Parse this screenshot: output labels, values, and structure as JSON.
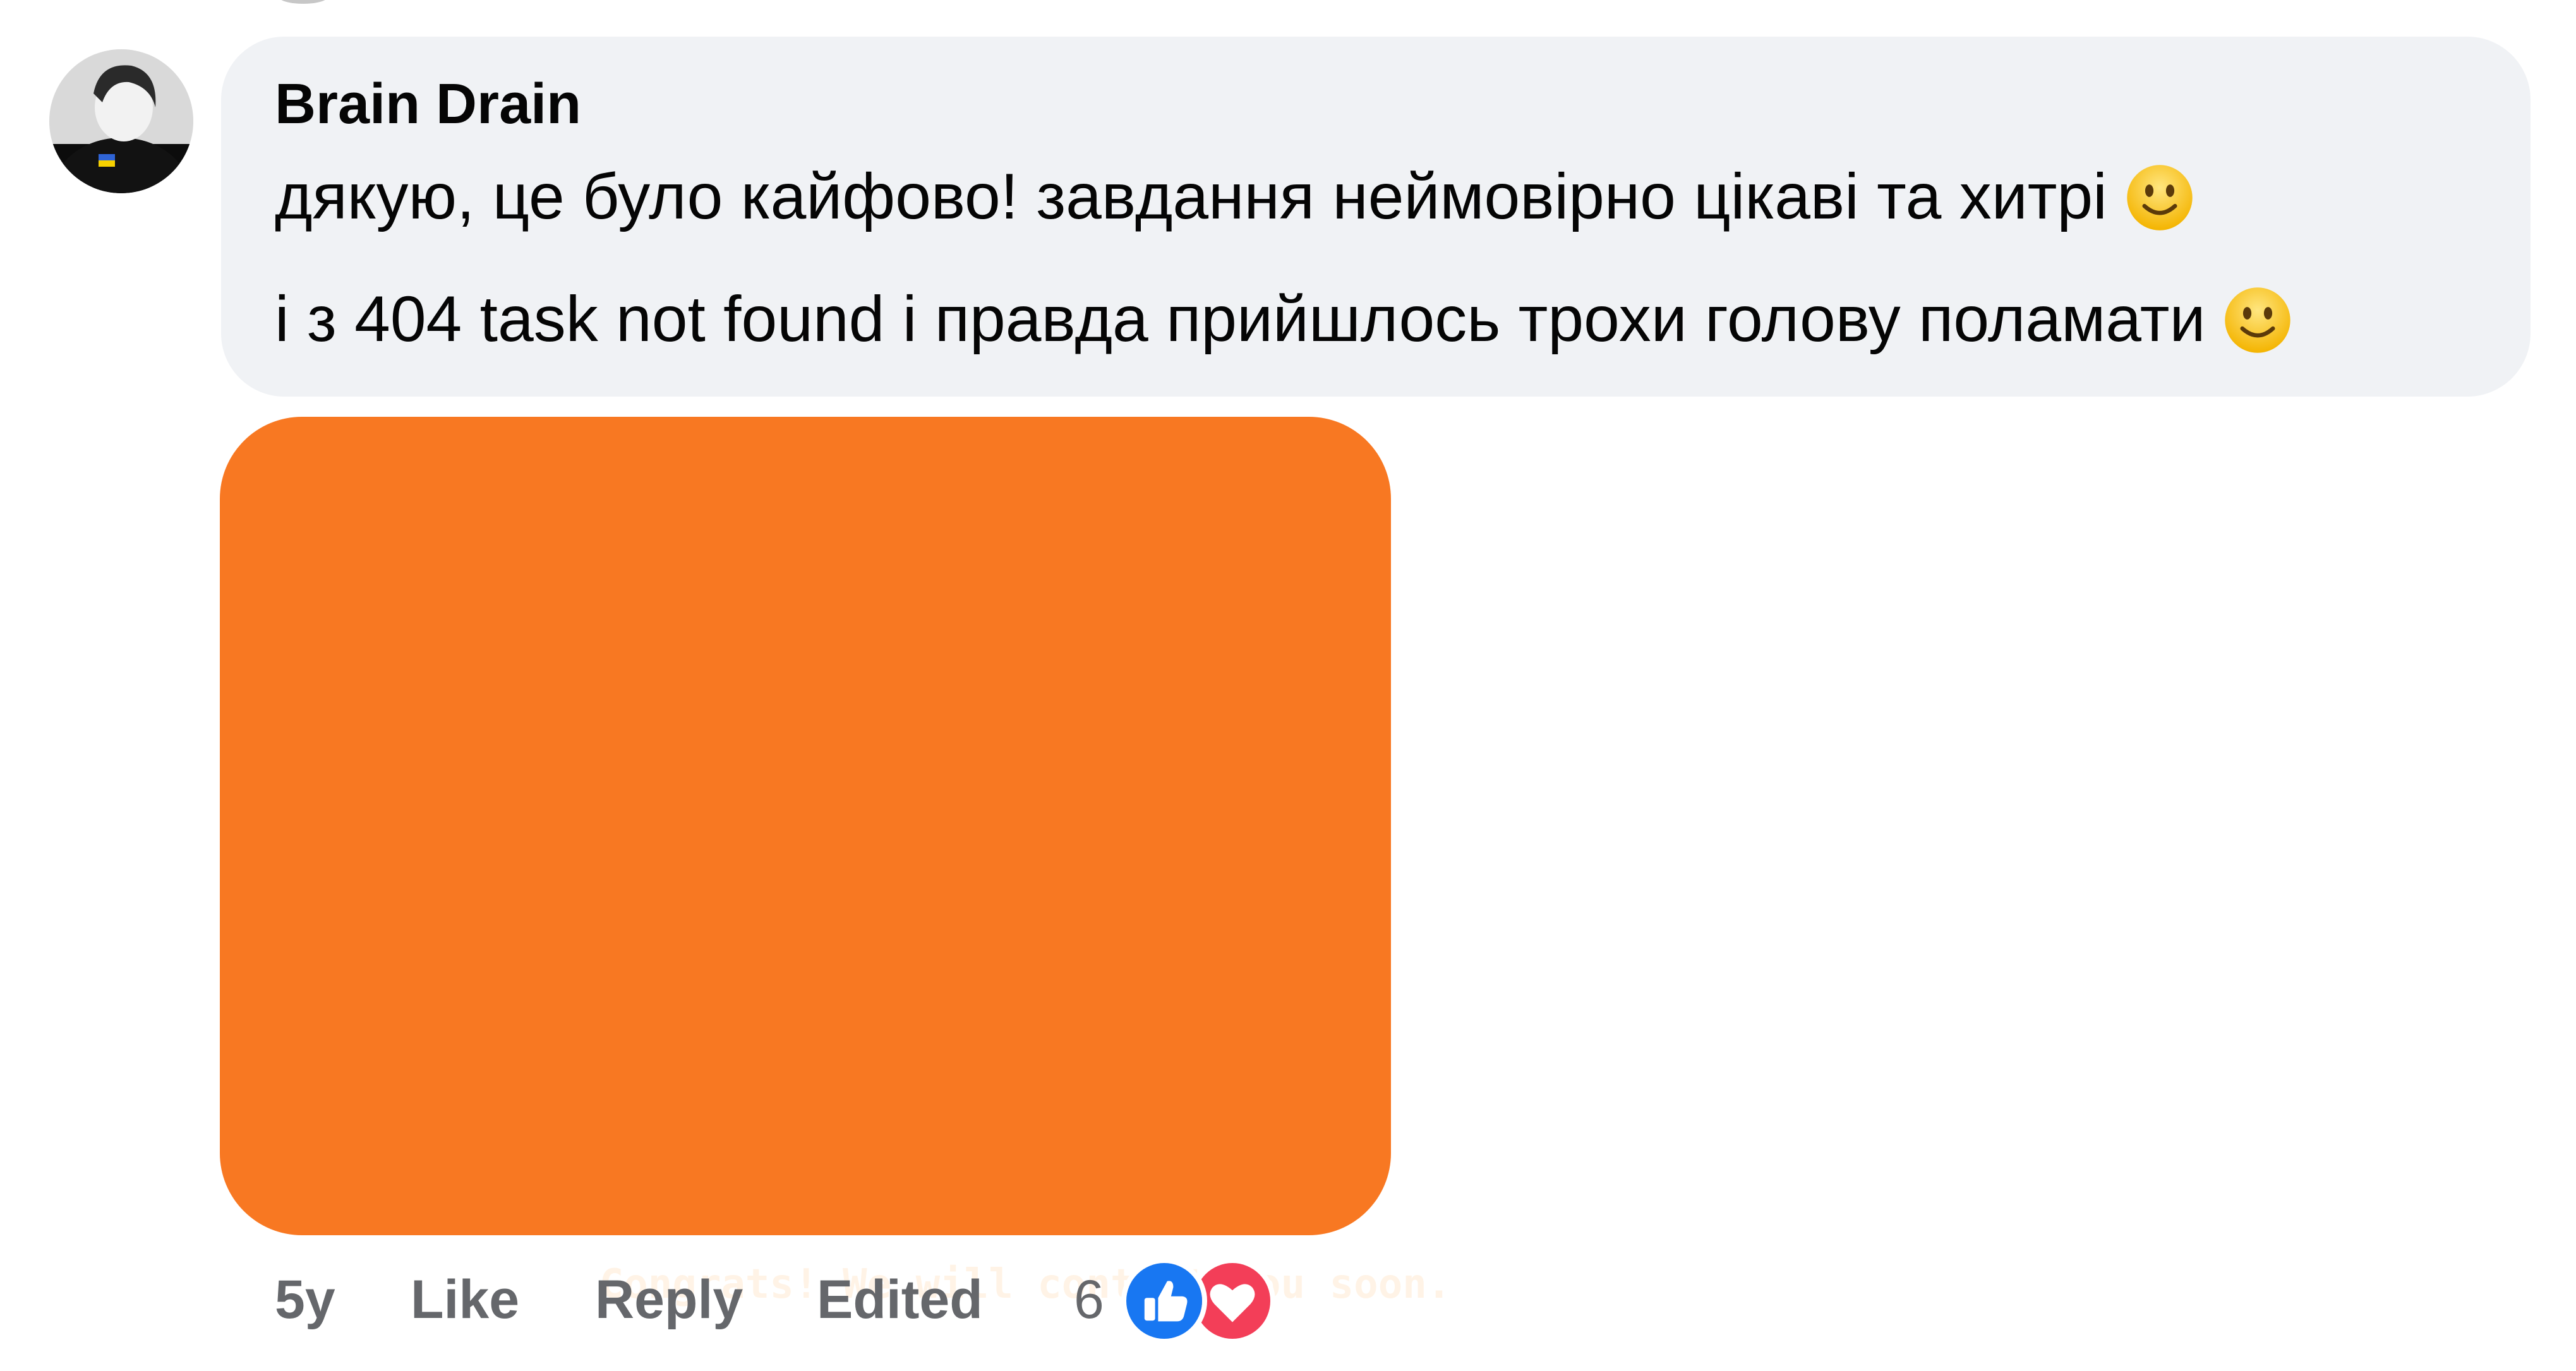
{
  "comment": {
    "author": "Brain Drain",
    "lines": [
      "дякую, це було кайфово! завдання неймовірно цікаві та хитрі",
      "і з 404 task not found і правда прийшлось трохи голову поламати"
    ],
    "line_emoji": [
      "slightly-smiling-face-emoji",
      "slightly-smiling-face-emoji"
    ],
    "attachment": {
      "text": "Congrats! We will contact you soon.",
      "background_color": "#f87822"
    }
  },
  "actions": {
    "time": "5y",
    "like": "Like",
    "reply": "Reply",
    "edited": "Edited",
    "reaction_count": "6",
    "reactions": [
      "like-icon",
      "love-icon"
    ]
  },
  "colors": {
    "bubble": "#f0f2f5",
    "text": "#050505",
    "muted": "#65676b",
    "like_blue": "#1877f2",
    "love_red": "#f33e58"
  }
}
